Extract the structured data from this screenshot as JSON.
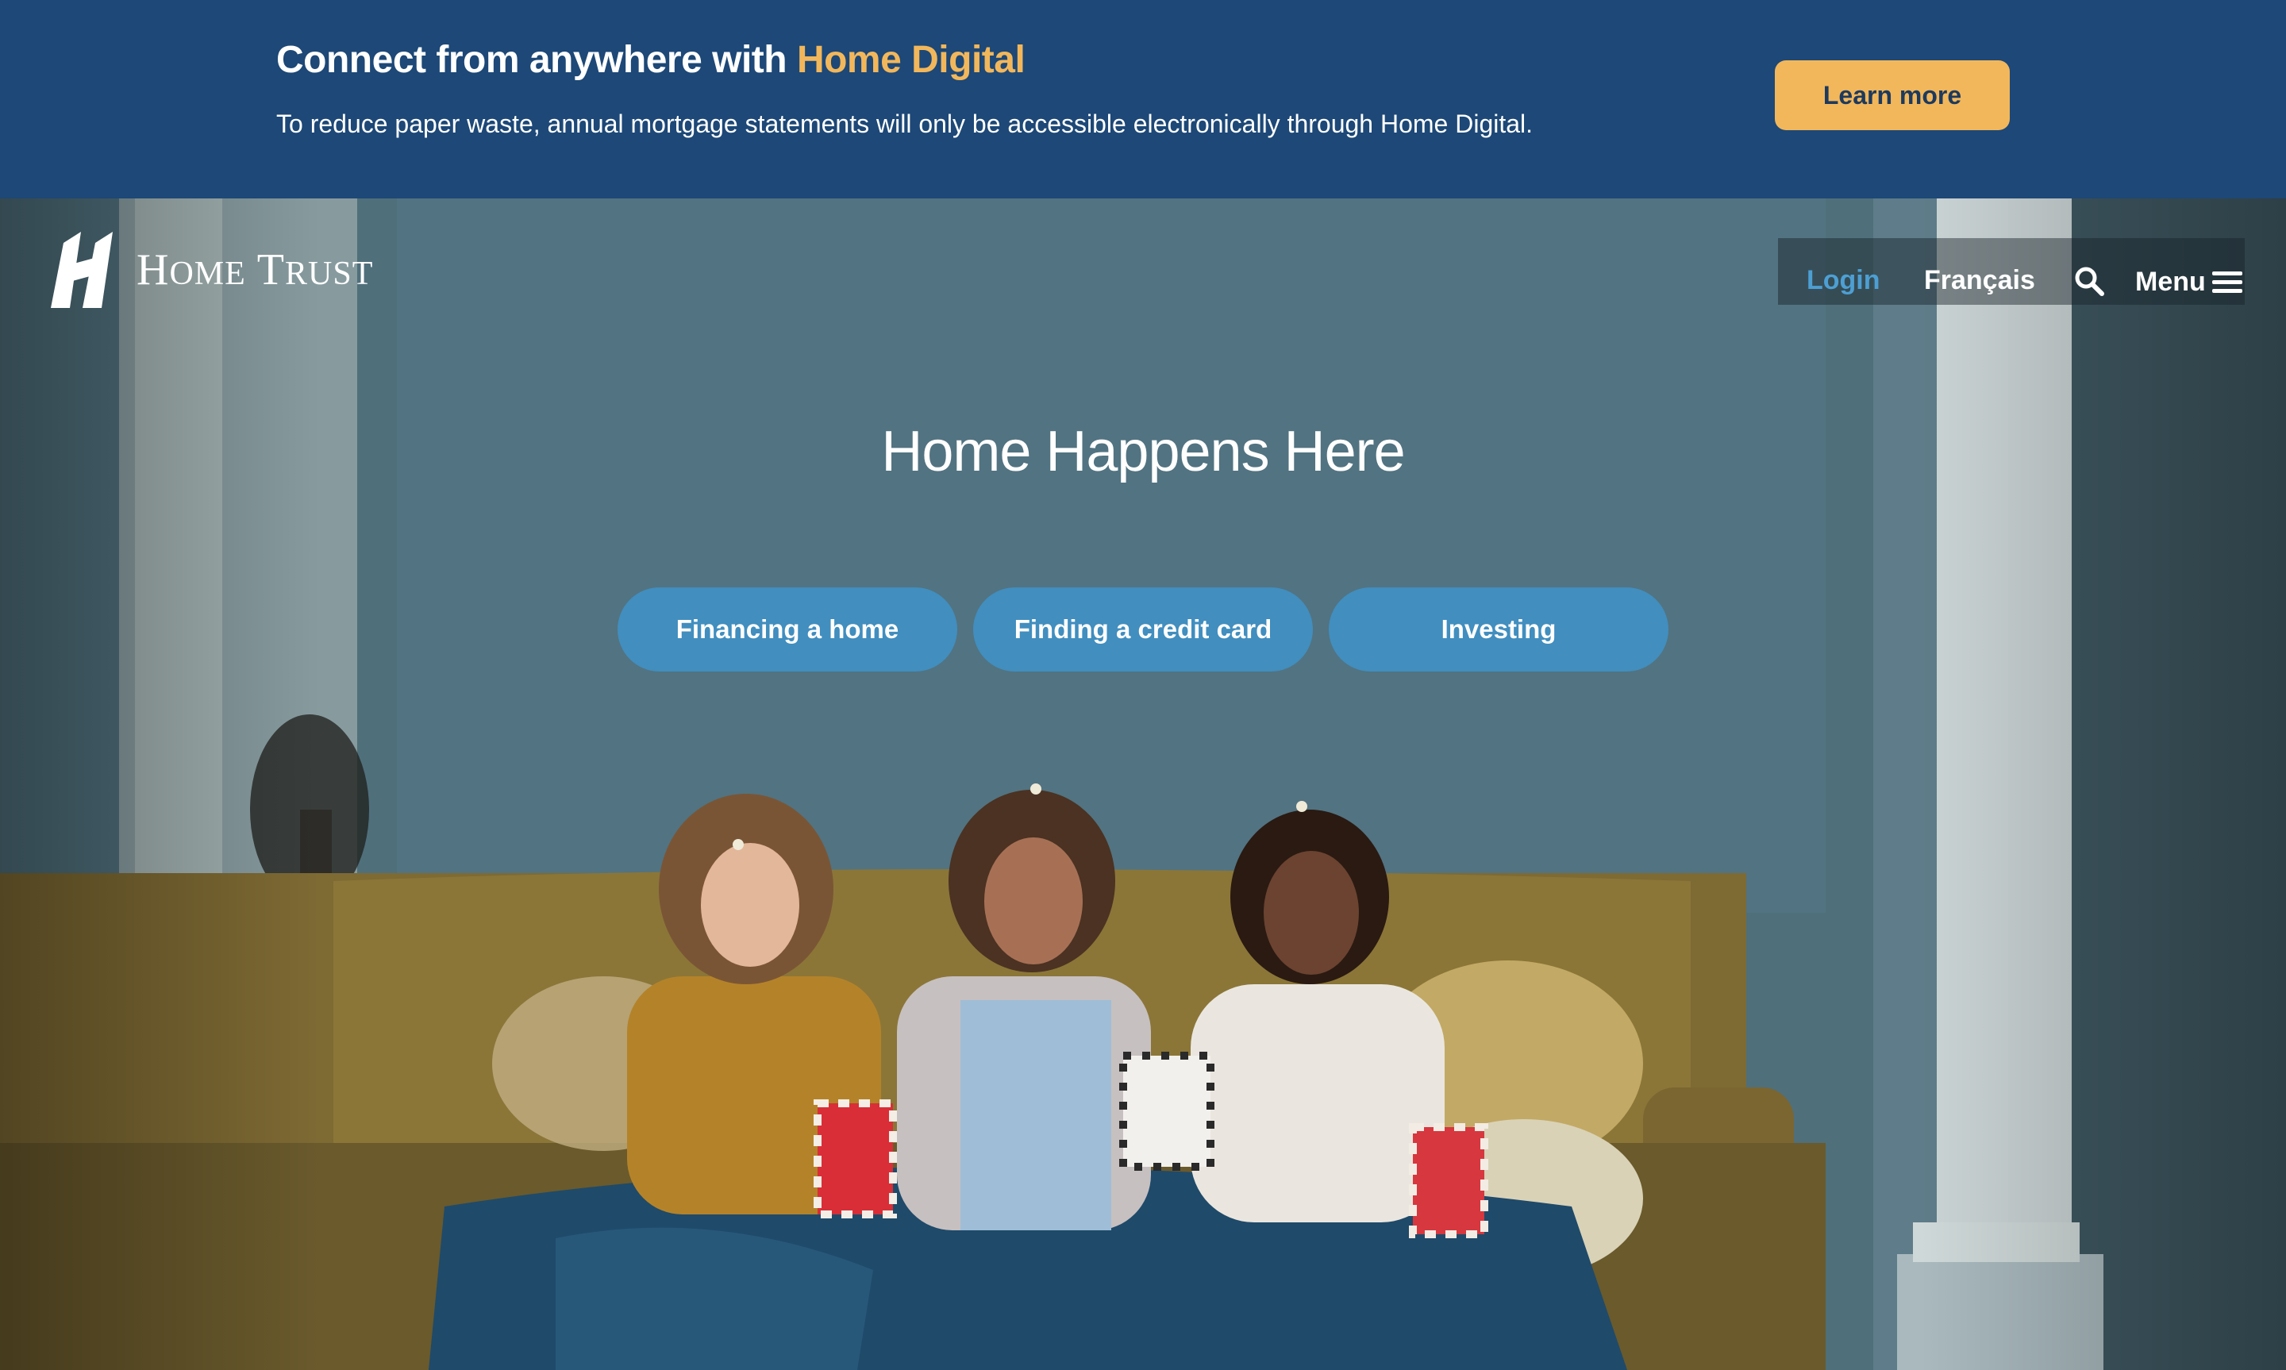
{
  "banner": {
    "heading_prefix": "Connect from anywhere with",
    "heading_highlight": "Home Digital",
    "text": "To reduce paper waste, annual mortgage statements will only be accessible electronically through Home Digital.",
    "button_label": "Learn more"
  },
  "header": {
    "logo": {
      "word_1_initial": "H",
      "word_1_rest": "OME",
      "word_2_initial": "T",
      "word_2_rest": "RUST"
    },
    "nav": {
      "login": "Login",
      "language": "Français",
      "search_icon": "search-icon",
      "menu_label": "Menu",
      "menu_icon": "hamburger-menu-icon"
    }
  },
  "hero": {
    "title": "Home Happens Here",
    "buttons": [
      {
        "label": "Financing a home"
      },
      {
        "label": "Finding a credit card"
      },
      {
        "label": "Investing"
      }
    ]
  },
  "colors": {
    "banner_bg": "#1d4877",
    "accent_yellow": "#f2b75b",
    "login_link": "#4d9fd3",
    "cta_bg": "#418ebf"
  }
}
